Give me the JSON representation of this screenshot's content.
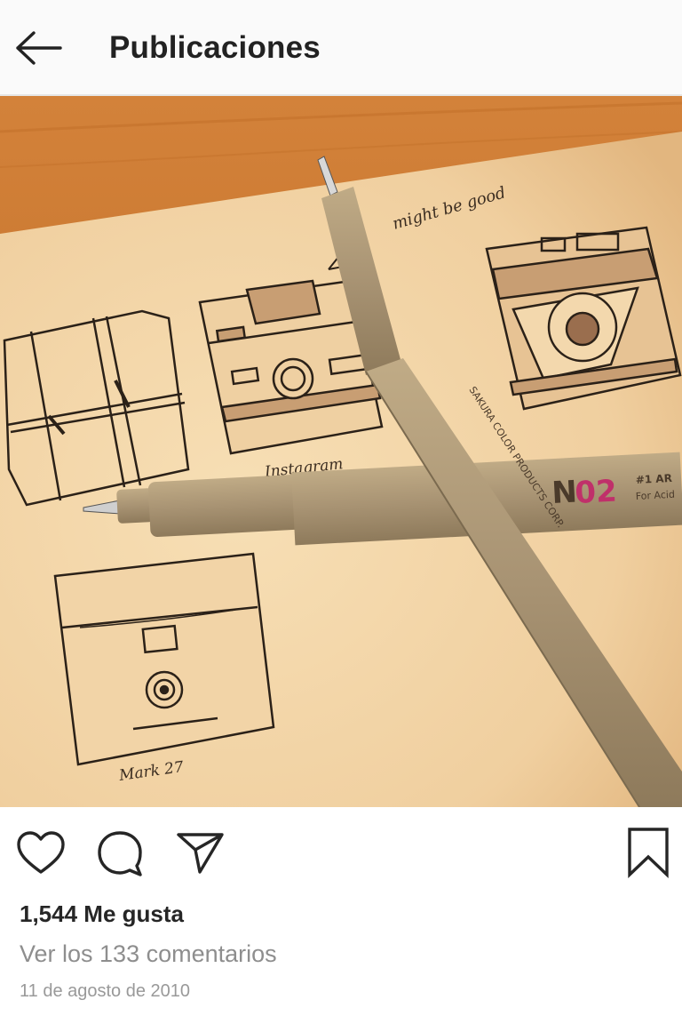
{
  "header": {
    "title": "Publicaciones",
    "back_icon": "arrow-left-icon"
  },
  "post": {
    "image": {
      "pen_brand": "N",
      "pen_model": "02",
      "pen_line1": "#1 AR",
      "pen_line2": "For Acid",
      "pen_sideline": "SAKURA COLOR PRODUCTS CORP.",
      "note": "might be good",
      "sketch_label_top": "Instagram",
      "sketch_label_bottom": "Mark 27"
    },
    "actions": {
      "like_icon": "heart-icon",
      "comment_icon": "comment-icon",
      "share_icon": "send-icon",
      "save_icon": "bookmark-icon"
    },
    "likes": "1,544 Me gusta",
    "comments_link": "Ver los 133 comentarios",
    "date": "11 de agosto de 2010"
  },
  "colors": {
    "header_bg": "#fafafa",
    "text_primary": "#262626",
    "text_secondary": "#8e8e8e",
    "paper": "#f4d7ab",
    "table": "#c9772d",
    "pen": "#a89373"
  }
}
